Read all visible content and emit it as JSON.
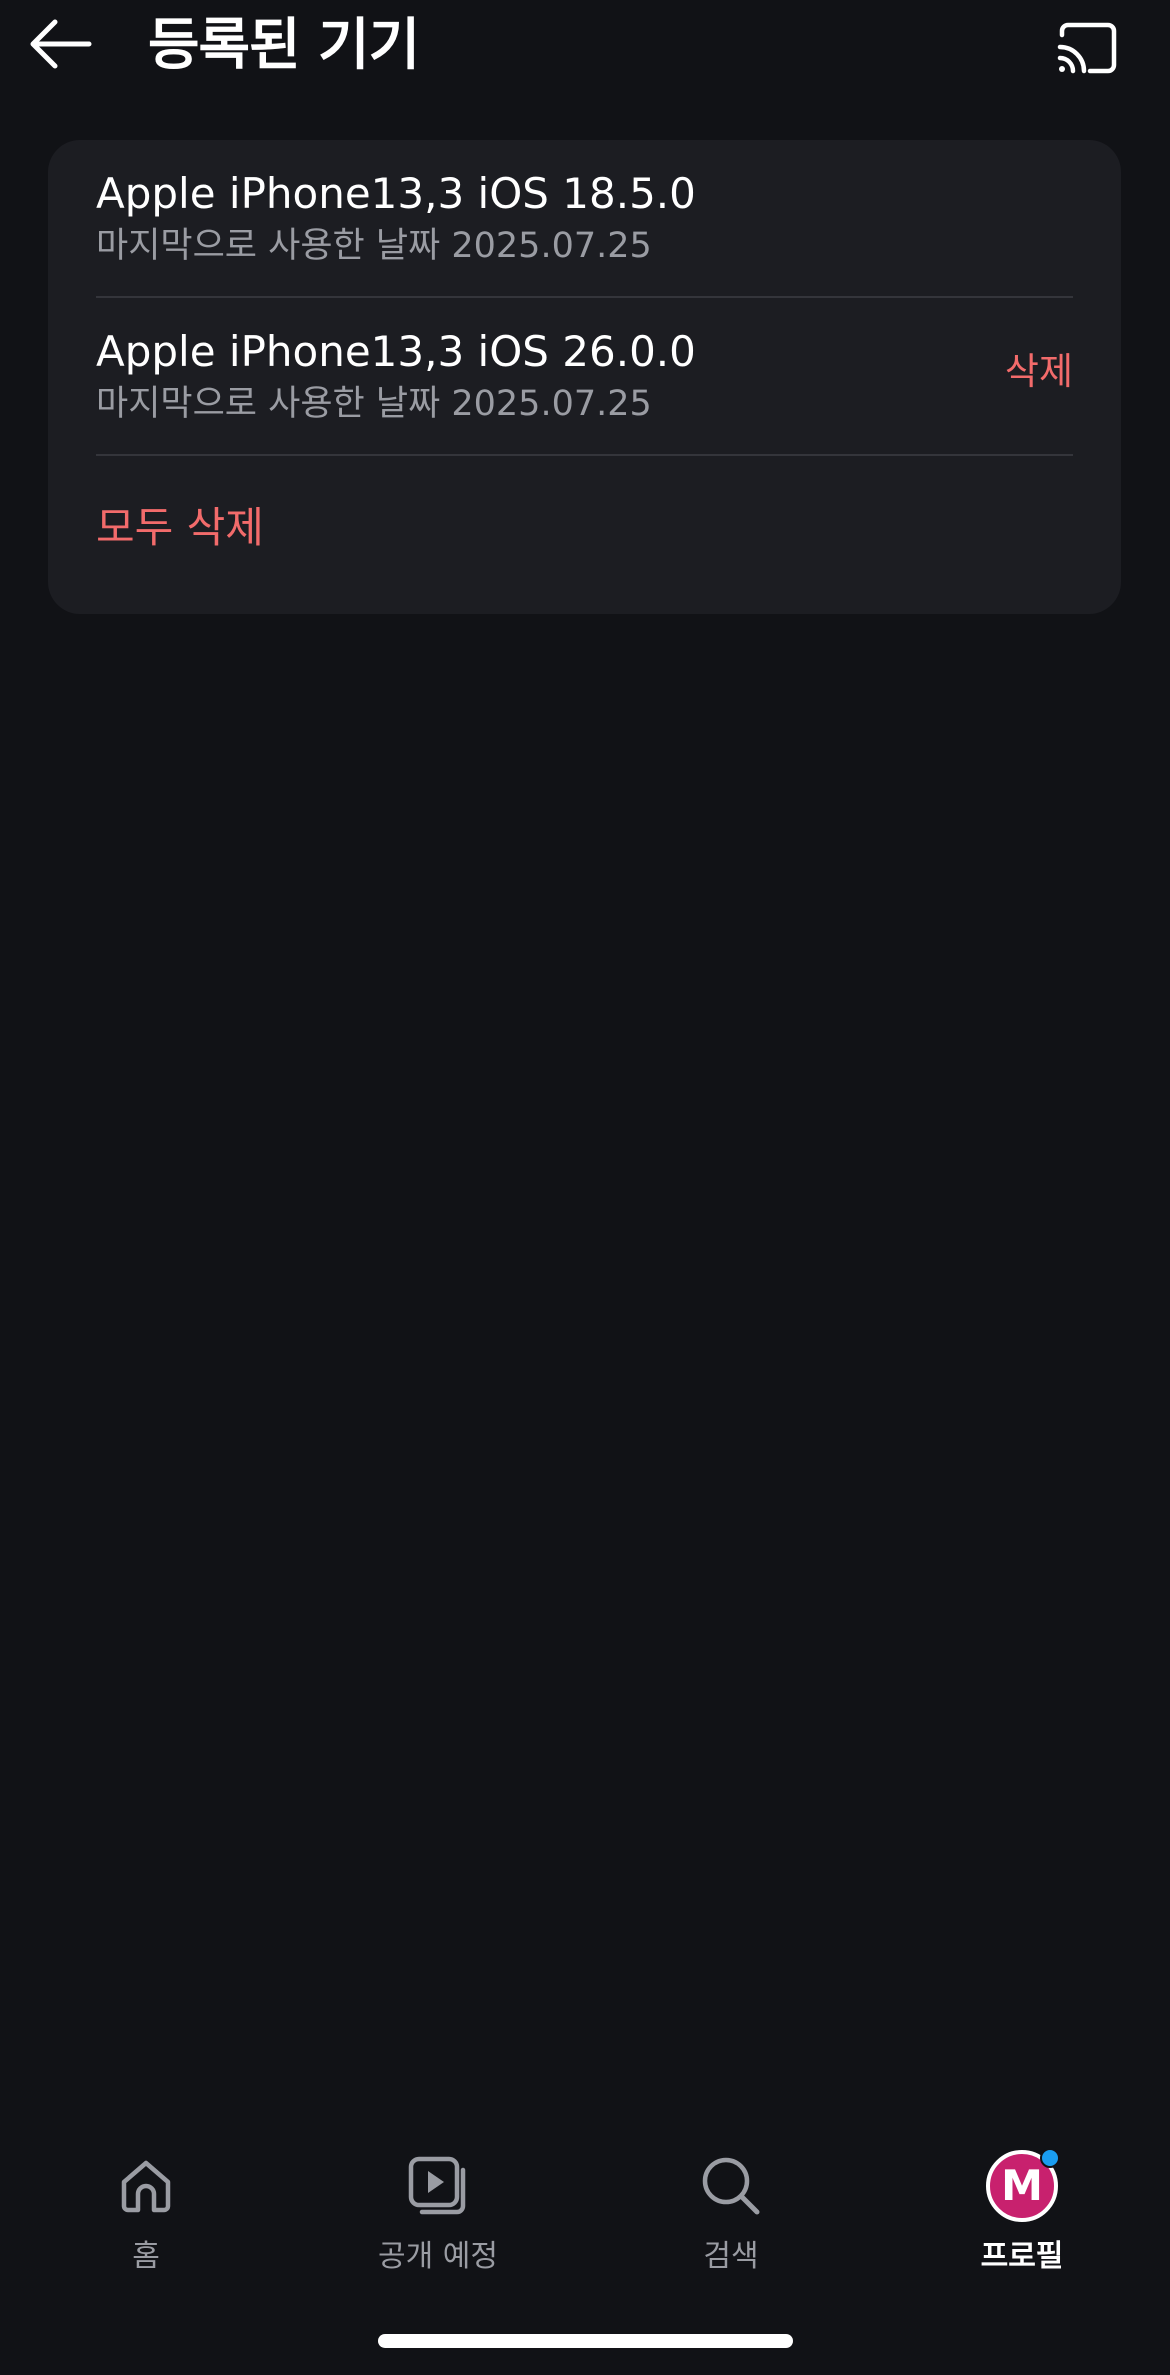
{
  "header": {
    "title": "등록된 기기",
    "back_icon": "arrow-left-icon",
    "cast_icon": "cast-icon"
  },
  "devices": [
    {
      "name": "Apple iPhone13,3 iOS 18.5.0",
      "last_used": "마지막으로 사용한 날짜 2025.07.25"
    },
    {
      "name": "Apple iPhone13,3 iOS 26.0.0",
      "last_used": "마지막으로 사용한 날짜 2025.07.25",
      "delete_label": "삭제"
    }
  ],
  "delete_all_label": "모두 삭제",
  "bottom_nav": {
    "items": [
      {
        "label": "홈",
        "icon": "home-icon"
      },
      {
        "label": "공개 예정",
        "icon": "upcoming-play-icon"
      },
      {
        "label": "검색",
        "icon": "search-icon"
      },
      {
        "label": "프로필",
        "icon": "profile-avatar",
        "active": true
      }
    ],
    "avatar_letter": "M"
  },
  "colors": {
    "background": "#111216",
    "card": "#1c1d22",
    "accent_red": "#f26b6b",
    "muted_text": "#9a9ca3",
    "avatar": "#c8216e",
    "notification_dot": "#1a9df0"
  }
}
